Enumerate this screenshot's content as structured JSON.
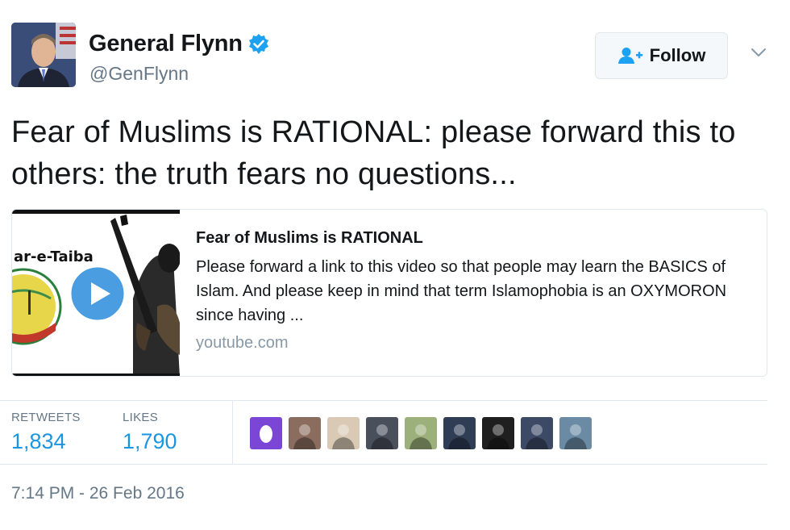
{
  "user": {
    "display_name": "General Flynn",
    "handle": "@GenFlynn",
    "verified": true,
    "avatar_icon": "profile-photo"
  },
  "follow_button": {
    "label": "Follow",
    "icon": "add-user-icon"
  },
  "menu_icon": "chevron-down-icon",
  "tweet": {
    "text": "Fear of Muslims is RATIONAL: please forward this to others: the truth fears no questions..."
  },
  "card": {
    "title": "Fear of Muslims is RATIONAL",
    "description": "Please forward a link to this video so that people may learn the BASICS of Islam. And please keep in mind that term Islamophobia is an OXYMORON since having ...",
    "domain": "youtube.com",
    "thumbnail_text": "ar-e-Taiba",
    "thumbnail_icon": "play-icon"
  },
  "stats": {
    "retweets_label": "RETWEETS",
    "retweets_value": "1,834",
    "likes_label": "LIKES",
    "likes_value": "1,790"
  },
  "likers": [
    {
      "color": "#7b45d6",
      "icon": "avatar-purple-egg"
    },
    {
      "color": "#8a6d5e",
      "icon": "avatar-photo"
    },
    {
      "color": "#d9c9b5",
      "icon": "avatar-photo"
    },
    {
      "color": "#4a4f5c",
      "icon": "avatar-photo"
    },
    {
      "color": "#9bb07a",
      "icon": "avatar-photo"
    },
    {
      "color": "#2f3d55",
      "icon": "avatar-photo"
    },
    {
      "color": "#1f1f1f",
      "icon": "avatar-photo"
    },
    {
      "color": "#3c4a66",
      "icon": "avatar-photo"
    },
    {
      "color": "#6b8aa3",
      "icon": "avatar-photo"
    }
  ],
  "timestamp": "7:14 PM - 26 Feb 2016",
  "colors": {
    "link_blue": "#1b95e0",
    "verified_blue": "#1da1f2",
    "muted": "#657786",
    "border": "#e1e8ed"
  }
}
